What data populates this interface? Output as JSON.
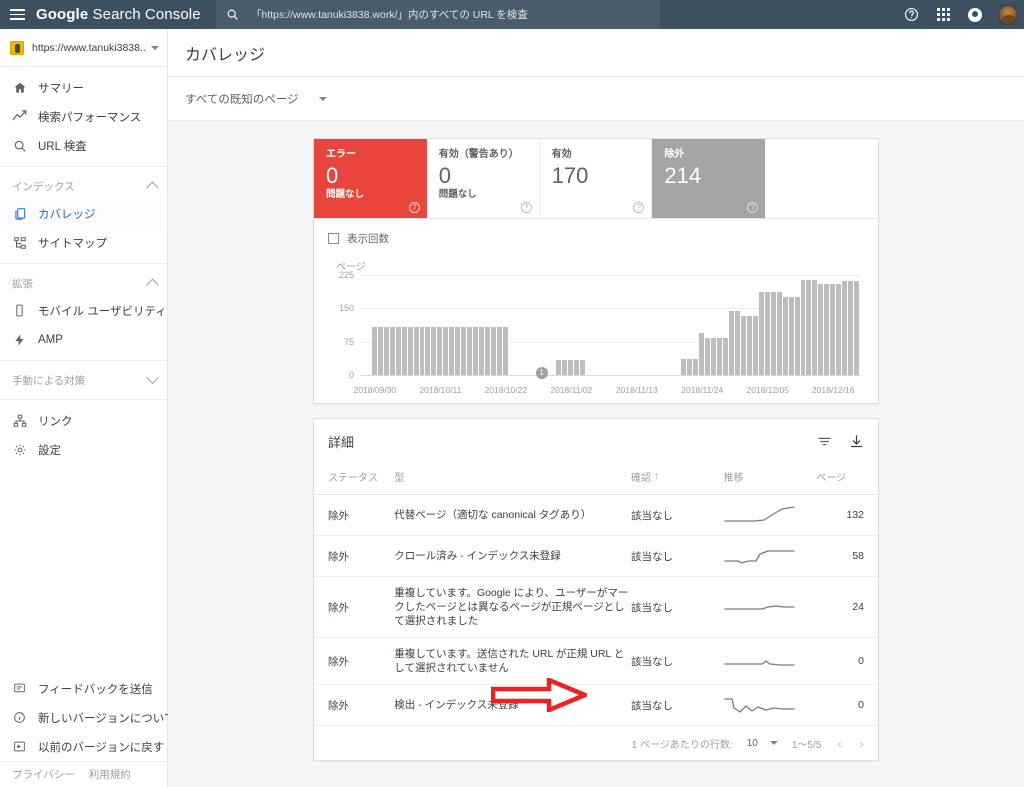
{
  "header": {
    "menu_label": "メニュー",
    "brand_bold": "Google",
    "brand_rest": " Search Console",
    "search_value": "「https://www.tanuki3838.work/」内のすべての URL を検査",
    "help_label": "?",
    "icons": [
      "help-icon",
      "apps-grid-icon",
      "notifications-icon",
      "avatar"
    ]
  },
  "sidebar": {
    "property": {
      "url": "https://www.tanuki3838....",
      "icon": "property-icon"
    },
    "top_items": [
      {
        "label": "サマリー",
        "icon": "home-icon",
        "active": false
      },
      {
        "label": "検索パフォーマンス",
        "icon": "trend-icon",
        "active": false
      },
      {
        "label": "URL 検査",
        "icon": "search-icon",
        "active": false
      }
    ],
    "groups": [
      {
        "label": "インデックス",
        "expanded": true,
        "items": [
          {
            "label": "カバレッジ",
            "icon": "pages-icon",
            "active": true
          },
          {
            "label": "サイトマップ",
            "icon": "sitemap-icon",
            "active": false
          }
        ]
      },
      {
        "label": "拡張",
        "expanded": true,
        "items": [
          {
            "label": "モバイル ユーザビリティ",
            "icon": "mobile-icon",
            "active": false
          },
          {
            "label": "AMP",
            "icon": "bolt-icon",
            "active": false
          }
        ]
      },
      {
        "label": "手動による対策",
        "expanded": false,
        "items": []
      }
    ],
    "bottom_items": [
      {
        "label": "リンク",
        "icon": "links-icon"
      },
      {
        "label": "設定",
        "icon": "gear-icon"
      }
    ],
    "utility_items": [
      {
        "label": "フィードバックを送信",
        "icon": "feedback-icon"
      },
      {
        "label": "新しいバージョンについて",
        "icon": "info-icon"
      },
      {
        "label": "以前のバージョンに戻す",
        "icon": "back-version-icon"
      }
    ],
    "footer": [
      "プライバシー",
      "利用規約"
    ]
  },
  "main": {
    "page_title": "カバレッジ",
    "filter": {
      "label": "すべての既知のページ"
    },
    "status_tiles": [
      {
        "label": "エラー",
        "value": "0",
        "sub": "問題なし",
        "style": "error",
        "help": "?"
      },
      {
        "label": "有効（警告あり）",
        "value": "0",
        "sub": "問題なし",
        "style": "plain",
        "help": "?"
      },
      {
        "label": "有効",
        "value": "170",
        "sub": "",
        "style": "plain",
        "help": "?"
      },
      {
        "label": "除外",
        "value": "214",
        "sub": "",
        "style": "excluded",
        "help": "?"
      }
    ],
    "legend": {
      "label": "表示回数",
      "checked": false
    }
  },
  "chart_data": {
    "type": "bar",
    "title": "",
    "ylabel": "ページ",
    "xlabel": "",
    "ylim": [
      0,
      225
    ],
    "yticks": [
      0,
      75,
      150,
      225
    ],
    "grid": true,
    "legend_position": "top-left",
    "series_name": "ページ",
    "bar_color": "#bdbdbd",
    "annotation": {
      "index": 30,
      "label": "1"
    },
    "xtick_labels": [
      "2018/09/30",
      "2018/10/11",
      "2018/10/22",
      "2018/11/02",
      "2018/11/13",
      "2018/11/24",
      "2018/12/05",
      "2018/12/16"
    ],
    "xtick_indices": [
      2,
      13,
      24,
      35,
      46,
      57,
      68,
      79
    ],
    "categories": [
      "2018/09/28",
      "2018/09/29",
      "2018/09/30",
      "2018/10/01",
      "2018/10/02",
      "2018/10/03",
      "2018/10/04",
      "2018/10/05",
      "2018/10/06",
      "2018/10/07",
      "2018/10/08",
      "2018/10/09",
      "2018/10/10",
      "2018/10/11",
      "2018/10/12",
      "2018/10/13",
      "2018/10/14",
      "2018/10/15",
      "2018/10/16",
      "2018/10/17",
      "2018/10/18",
      "2018/10/19",
      "2018/10/20",
      "2018/10/21",
      "2018/10/22",
      "2018/10/23",
      "2018/10/24",
      "2018/10/25",
      "2018/10/26",
      "2018/10/27",
      "2018/10/28",
      "2018/10/29",
      "2018/10/30",
      "2018/10/31",
      "2018/11/01",
      "2018/11/02",
      "2018/11/03",
      "2018/11/04",
      "2018/11/05",
      "2018/11/06",
      "2018/11/07",
      "2018/11/08",
      "2018/11/09",
      "2018/11/10",
      "2018/11/11",
      "2018/11/12",
      "2018/11/13",
      "2018/11/14",
      "2018/11/15",
      "2018/11/16",
      "2018/11/17",
      "2018/11/18",
      "2018/11/19",
      "2018/11/20",
      "2018/11/21",
      "2018/11/22",
      "2018/11/23",
      "2018/11/24",
      "2018/11/25",
      "2018/11/26",
      "2018/11/27",
      "2018/11/28",
      "2018/11/29",
      "2018/11/30",
      "2018/12/01",
      "2018/12/02",
      "2018/12/03",
      "2018/12/04",
      "2018/12/05",
      "2018/12/06",
      "2018/12/07",
      "2018/12/08",
      "2018/12/09",
      "2018/12/10",
      "2018/12/11",
      "2018/12/12",
      "2018/12/13",
      "2018/12/14",
      "2018/12/15",
      "2018/12/16",
      "2018/12/17",
      "2018/12/18",
      "2018/12/19",
      "2018/12/20"
    ],
    "values": [
      0,
      0,
      108,
      108,
      108,
      108,
      108,
      108,
      108,
      108,
      108,
      108,
      108,
      108,
      108,
      108,
      108,
      108,
      108,
      108,
      108,
      108,
      108,
      108,
      108,
      0,
      0,
      0,
      0,
      0,
      0,
      0,
      0,
      34,
      34,
      34,
      34,
      34,
      0,
      0,
      0,
      0,
      0,
      0,
      0,
      0,
      0,
      0,
      0,
      0,
      0,
      0,
      0,
      0,
      35,
      35,
      35,
      95,
      83,
      83,
      83,
      83,
      145,
      145,
      133,
      133,
      133,
      187,
      187,
      187,
      187,
      175,
      175,
      175,
      213,
      213,
      213,
      205,
      205,
      205,
      205,
      211,
      211,
      211
    ]
  },
  "details": {
    "title": "詳細",
    "actions": [
      {
        "name": "filter-icon",
        "label": "フィルタ"
      },
      {
        "name": "download-icon",
        "label": "ダウンロード"
      }
    ],
    "columns": [
      "ステータス",
      "型",
      "確認",
      "推移",
      "ページ"
    ],
    "sort_column": "確認",
    "sort_direction": "↑",
    "rows": [
      {
        "status": "除外",
        "type": "代替ページ（適切な canonical タグあり）",
        "validation": "該当なし",
        "trend": "rising-late",
        "pages": "132"
      },
      {
        "status": "除外",
        "type": "クロール済み - インデックス未登録",
        "validation": "該当なし",
        "trend": "step-up",
        "pages": "58"
      },
      {
        "status": "除外",
        "type": "重複しています。Google により、ユーザーがマークしたページとは異なるページが正規ページとして選択されました",
        "validation": "該当なし",
        "trend": "flat-bump",
        "pages": "24"
      },
      {
        "status": "除外",
        "type": "重複しています。送信された URL が正規 URL として選択されていません",
        "validation": "該当なし",
        "trend": "flat-small-bump",
        "pages": "0"
      },
      {
        "status": "除外",
        "type": "検出 - インデックス未登録",
        "validation": "該当なし",
        "trend": "drop-wobble",
        "pages": "0"
      }
    ],
    "pagination": {
      "rows_label": "1 ページあたりの行数:",
      "rows_value": "10",
      "range": "1〜5/5",
      "prev": "‹",
      "next": "›"
    }
  },
  "annotation": {
    "arrow_color": "#ee2222",
    "name": "red-arrow-annotation"
  },
  "colors": {
    "header_bg": "#3c5060",
    "error_red": "#e8453c",
    "excluded_gray": "#a5a5a5",
    "bar_gray": "#bdbdbd",
    "accent_blue": "#1a73e8"
  }
}
